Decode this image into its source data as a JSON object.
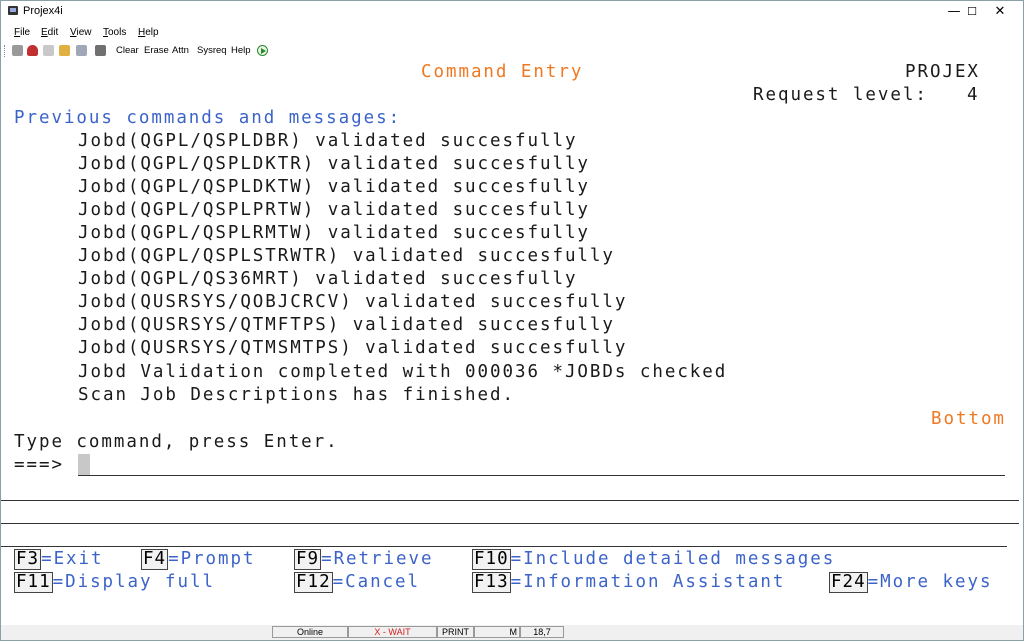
{
  "window": {
    "title": "Projex4i",
    "controls": {
      "minimize": "—",
      "maximize": "☐",
      "close": "✕"
    }
  },
  "menu": {
    "items": [
      {
        "label": "File",
        "ul": "F",
        "rest": "ile"
      },
      {
        "label": "Edit",
        "ul": "E",
        "rest": "dit"
      },
      {
        "label": "View",
        "ul": "V",
        "rest": "iew"
      },
      {
        "label": "Tools",
        "ul": "T",
        "rest": "ools"
      },
      {
        "label": "Help",
        "ul": "H",
        "rest": "elp"
      }
    ]
  },
  "toolbar": {
    "clear": "Clear",
    "erase": "Erase",
    "attn": "Attn",
    "sysreq": "Sysreq",
    "help": "Help"
  },
  "screen": {
    "title": "Command Entry",
    "system": "PROJEX",
    "request_level_label": "Request level:",
    "request_level_value": "4",
    "prev_header": "Previous commands and messages:",
    "messages": [
      "Jobd(QGPL/QSPLDBR) validated succesfully",
      "Jobd(QGPL/QSPLDKTR) validated succesfully",
      "Jobd(QGPL/QSPLDKTW) validated succesfully",
      "Jobd(QGPL/QSPLPRTW) validated succesfully",
      "Jobd(QGPL/QSPLRMTW) validated succesfully",
      "Jobd(QGPL/QSPLSTRWTR) validated succesfully",
      "Jobd(QGPL/QS36MRT) validated succesfully",
      "Jobd(QUSRSYS/QOBJCRCV) validated succesfully",
      "Jobd(QUSRSYS/QTMFTPS) validated succesfully",
      "Jobd(QUSRSYS/QTMSMTPS) validated succesfully",
      "Jobd Validation completed with 000036 *JOBDs checked",
      "Scan Job Descriptions has finished."
    ],
    "bottom": "Bottom",
    "prompt_text": "Type command, press Enter.",
    "arrow": "===>",
    "command_value": "",
    "fkeys_row1": [
      {
        "key": "F3",
        "desc": "=Exit"
      },
      {
        "key": "F4",
        "desc": "=Prompt"
      },
      {
        "key": "F9",
        "desc": "=Retrieve"
      },
      {
        "key": "F10",
        "desc": "=Include detailed messages"
      }
    ],
    "fkeys_row2": [
      {
        "key": "F11",
        "desc": "=Display full"
      },
      {
        "key": "F12",
        "desc": "=Cancel"
      },
      {
        "key": "F13",
        "desc": "=Information Assistant"
      },
      {
        "key": "F24",
        "desc": "=More keys"
      }
    ]
  },
  "status": {
    "connection": "Online",
    "wait": "X - WAIT",
    "print": "PRINT",
    "mode": "M",
    "cursor_pos": "18,7"
  },
  "colors": {
    "title_orange": "#f07820",
    "header_blue": "#3c64c8",
    "text_dark": "#1a1a1a"
  }
}
